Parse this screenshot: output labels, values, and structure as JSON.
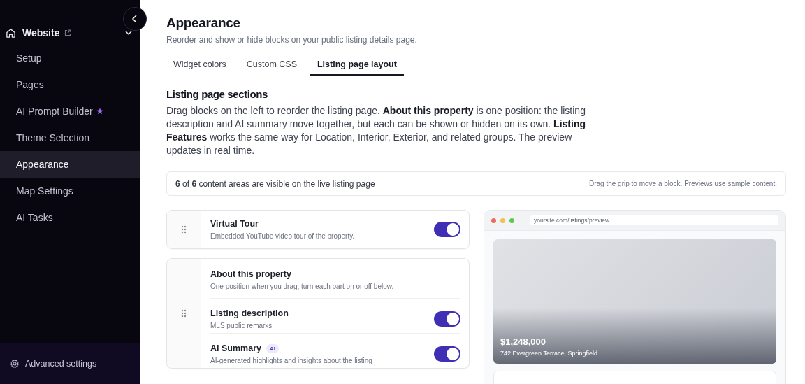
{
  "sidebar": {
    "section": {
      "label": "Website",
      "expanded": true
    },
    "items": [
      {
        "label": "Setup",
        "selected": false,
        "starred": false
      },
      {
        "label": "Pages",
        "selected": false,
        "starred": false
      },
      {
        "label": "AI Prompt Builder",
        "selected": false,
        "starred": true
      },
      {
        "label": "Theme Selection",
        "selected": false,
        "starred": false
      },
      {
        "label": "Appearance",
        "selected": true,
        "starred": false
      },
      {
        "label": "Map Settings",
        "selected": false,
        "starred": false
      },
      {
        "label": "AI Tasks",
        "selected": false,
        "starred": false
      }
    ],
    "footer": "Advanced settings"
  },
  "page": {
    "title": "Appearance",
    "subtitle": "Reorder and show or hide blocks on your public listing details page."
  },
  "tabs": [
    {
      "label": "Widget colors",
      "selected": false
    },
    {
      "label": "Custom CSS",
      "selected": false
    },
    {
      "label": "Listing page layout",
      "selected": true
    }
  ],
  "section": {
    "heading": "Listing page sections",
    "description": "Drag blocks on the left to reorder the listing page. **About this property** is one position: the listing description and AI summary move together, but each can be shown or hidden on its own. **Listing Features** works the same way for Location, Interior, Exterior, and related groups. The preview updates in real time."
  },
  "summary": {
    "text": "**6** of **6** content areas are visible on the live listing page",
    "hint": "Drag the grip to move a block. Previews use sample content."
  },
  "blocks": [
    {
      "kind": "single",
      "title": "Virtual Tour",
      "subtitle": "Embedded YouTube video tour of the property.",
      "on": true
    },
    {
      "kind": "group",
      "title": "About this property",
      "subtitle": "One position when you drag; turn each part on or off below.",
      "parts": [
        {
          "title": "Listing description",
          "subtitle": "MLS public remarks",
          "on": true
        },
        {
          "title": "AI Summary",
          "badge": "AI",
          "subtitle": "AI-generated highlights and insights about the listing",
          "on": true
        }
      ]
    }
  ],
  "preview": {
    "url": "yoursite.com/listings/preview",
    "price": "$1,248,000",
    "address": "742 Evergreen Terrace, Springfield"
  }
}
